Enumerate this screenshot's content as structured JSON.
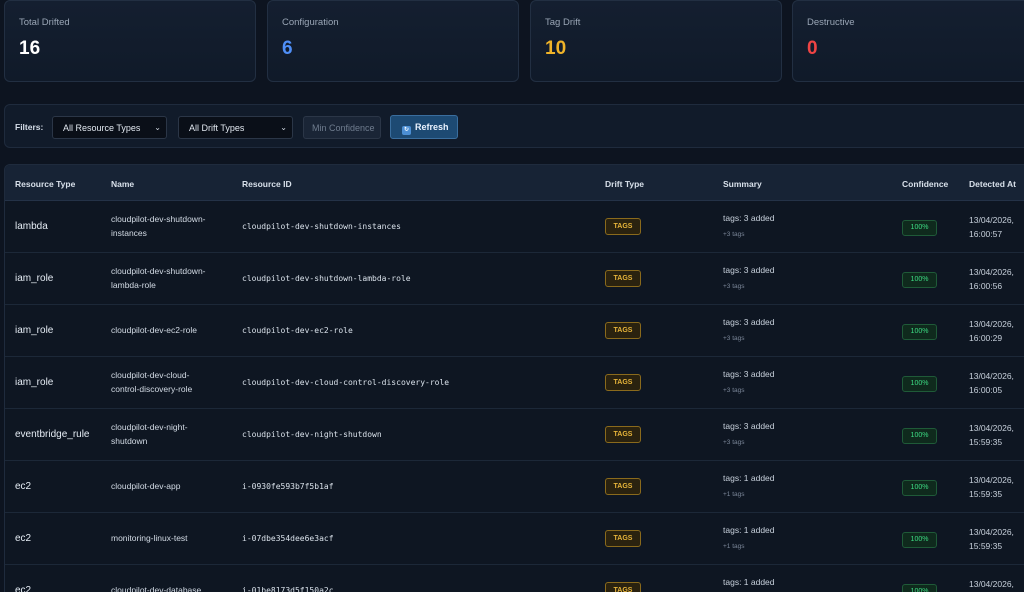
{
  "stats": [
    {
      "label": "Total Drifted",
      "value": "16",
      "color": "#ffffff"
    },
    {
      "label": "Configuration",
      "value": "6",
      "color": "#4f8ff7"
    },
    {
      "label": "Tag Drift",
      "value": "10",
      "color": "#f0b429"
    },
    {
      "label": "Destructive",
      "value": "0",
      "color": "#ef4444"
    }
  ],
  "filters": {
    "label": "Filters:",
    "resource_type": "All Resource Types",
    "drift_type": "All Drift Types",
    "min_confidence_placeholder": "Min Confidence",
    "refresh_label": "Refresh"
  },
  "table": {
    "headers": [
      "Resource Type",
      "Name",
      "Resource ID",
      "Drift Type",
      "Summary",
      "Confidence",
      "Detected At"
    ],
    "rows": [
      {
        "type": "lambda",
        "name_l1": "cloudpilot-dev-shutdown-",
        "name_l2": "instances",
        "id": "cloudpilot-dev-shutdown-instances",
        "drift": "TAGS",
        "summary": "tags: 3 added",
        "sub": "+3 tags",
        "confidence": "100%",
        "date": "13/04/2026,",
        "time": "16:00:57"
      },
      {
        "type": "iam_role",
        "name_l1": "cloudpilot-dev-shutdown-",
        "name_l2": "lambda-role",
        "id": "cloudpilot-dev-shutdown-lambda-role",
        "drift": "TAGS",
        "summary": "tags: 3 added",
        "sub": "+3 tags",
        "confidence": "100%",
        "date": "13/04/2026,",
        "time": "16:00:56"
      },
      {
        "type": "iam_role",
        "name_l1": "cloudpilot-dev-ec2-role",
        "name_l2": "",
        "id": "cloudpilot-dev-ec2-role",
        "drift": "TAGS",
        "summary": "tags: 3 added",
        "sub": "+3 tags",
        "confidence": "100%",
        "date": "13/04/2026,",
        "time": "16:00:29"
      },
      {
        "type": "iam_role",
        "name_l1": "cloudpilot-dev-cloud-",
        "name_l2": "control-discovery-role",
        "id": "cloudpilot-dev-cloud-control-discovery-role",
        "drift": "TAGS",
        "summary": "tags: 3 added",
        "sub": "+3 tags",
        "confidence": "100%",
        "date": "13/04/2026,",
        "time": "16:00:05"
      },
      {
        "type": "eventbridge_rule",
        "name_l1": "cloudpilot-dev-night-",
        "name_l2": "shutdown",
        "id": "cloudpilot-dev-night-shutdown",
        "drift": "TAGS",
        "summary": "tags: 3 added",
        "sub": "+3 tags",
        "confidence": "100%",
        "date": "13/04/2026,",
        "time": "15:59:35"
      },
      {
        "type": "ec2",
        "name_l1": "cloudpilot-dev-app",
        "name_l2": "",
        "id": "i-0930fe593b7f5b1af",
        "drift": "TAGS",
        "summary": "tags: 1 added",
        "sub": "+1 tags",
        "confidence": "100%",
        "date": "13/04/2026,",
        "time": "15:59:35"
      },
      {
        "type": "ec2",
        "name_l1": "monitoring-linux-test",
        "name_l2": "",
        "id": "i-07dbe354dee6e3acf",
        "drift": "TAGS",
        "summary": "tags: 1 added",
        "sub": "+1 tags",
        "confidence": "100%",
        "date": "13/04/2026,",
        "time": "15:59:35"
      },
      {
        "type": "ec2",
        "name_l1": "cloudpilot-dev-database",
        "name_l2": "",
        "id": "i-01be8173d5f150a2c",
        "drift": "TAGS",
        "summary": "tags: 1 added",
        "sub": "",
        "confidence": "100%",
        "date": "13/04/2026,",
        "time": ""
      }
    ]
  }
}
